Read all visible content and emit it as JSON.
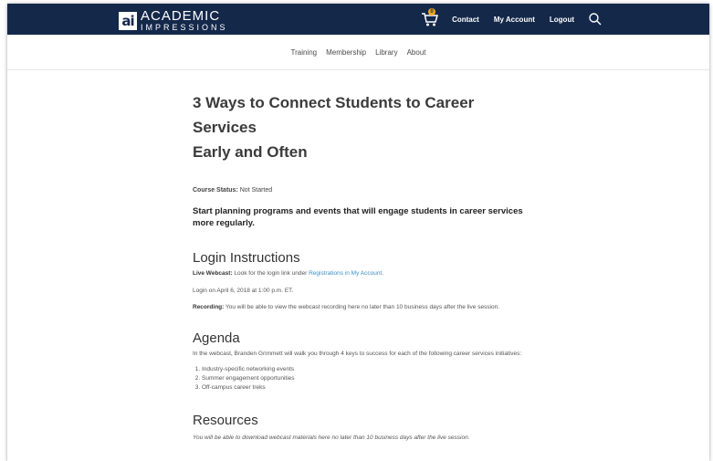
{
  "header": {
    "logo_mark": "ai",
    "logo_line1": "ACADEMIC",
    "logo_line2": "IMPRESSIONS",
    "cart_count": "0",
    "links": [
      "Contact",
      "My Account",
      "Logout"
    ]
  },
  "subnav": [
    "Training",
    "Membership",
    "Library",
    "About"
  ],
  "page": {
    "title_line1": "3 Ways to Connect Students to Career Services",
    "title_line2": "Early and Often",
    "status_label": "Course Status:",
    "status_value": "Not Started",
    "lead": "Start planning programs and events that will engage students in career services more regularly."
  },
  "login": {
    "heading": "Login Instructions",
    "webcast_label": "Live Webcast:",
    "webcast_text": "Look for the login link under",
    "webcast_link": "Registrations in My Account",
    "webcast_end": ".",
    "login_time": "Login on April 6, 2018 at 1:00 p.m. ET.",
    "recording_label": "Recording:",
    "recording_text": "You will be able to view the webcast recording here no later than 10 business days after the live session."
  },
  "agenda": {
    "heading": "Agenda",
    "intro": "In the webcast, Branden Grimmett will walk you through 4 keys to success for each of the following career services initiatives:",
    "items": [
      "Industry-specific networking events",
      "Summer engagement opportunities",
      "Off-campus career treks"
    ]
  },
  "resources": {
    "heading": "Resources",
    "text": "You will be able to download webcast materials here no later than 10 business days after the live session."
  },
  "colors": {
    "header_bg": "#14284a",
    "link": "#3a8fc4",
    "cart_badge": "#f2a81d"
  }
}
